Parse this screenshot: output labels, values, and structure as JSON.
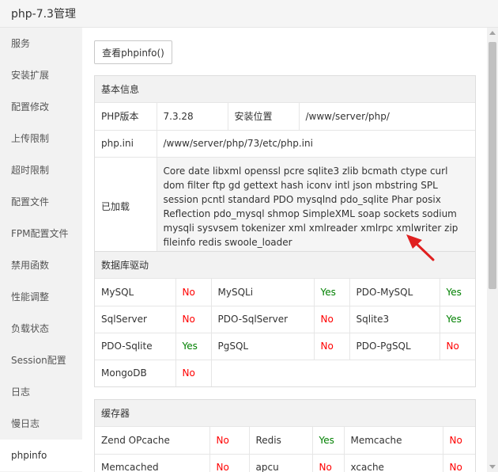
{
  "window": {
    "title": "php-7.3管理"
  },
  "sidebar": {
    "items": [
      {
        "label": "服务"
      },
      {
        "label": "安装扩展"
      },
      {
        "label": "配置修改"
      },
      {
        "label": "上传限制"
      },
      {
        "label": "超时限制"
      },
      {
        "label": "配置文件"
      },
      {
        "label": "FPM配置文件"
      },
      {
        "label": "禁用函数"
      },
      {
        "label": "性能调整"
      },
      {
        "label": "负载状态"
      },
      {
        "label": "Session配置"
      },
      {
        "label": "日志"
      },
      {
        "label": "慢日志"
      },
      {
        "label": "phpinfo"
      }
    ],
    "active_index": 13
  },
  "main": {
    "phpinfo_button": "查看phpinfo()",
    "basic_info": {
      "title": "基本信息",
      "php_version_label": "PHP版本",
      "php_version_value": "7.3.28",
      "install_path_label": "安装位置",
      "install_path_value": "/www/server/php/",
      "php_ini_label": "php.ini",
      "php_ini_value": "/www/server/php/73/etc/php.ini",
      "loaded_label": "已加载",
      "loaded_value": "Core date libxml openssl pcre sqlite3 zlib bcmath ctype curl dom filter ftp gd gettext hash iconv intl json mbstring SPL session pcntl standard PDO mysqlnd pdo_sqlite Phar posix Reflection pdo_mysql shmop SimpleXML soap sockets sodium mysqli sysvsem tokenizer xml xmlreader xmlrpc xmlwriter zip fileinfo redis swoole_loader"
    },
    "db_drivers": {
      "title": "数据库驱动",
      "rows": [
        [
          {
            "name": "MySQL",
            "status": "No"
          },
          {
            "name": "MySQLi",
            "status": "Yes"
          },
          {
            "name": "PDO-MySQL",
            "status": "Yes"
          }
        ],
        [
          {
            "name": "SqlServer",
            "status": "No"
          },
          {
            "name": "PDO-SqlServer",
            "status": "No"
          },
          {
            "name": "Sqlite3",
            "status": "Yes"
          }
        ],
        [
          {
            "name": "PDO-Sqlite",
            "status": "Yes"
          },
          {
            "name": "PgSQL",
            "status": "No"
          },
          {
            "name": "PDO-PgSQL",
            "status": "No"
          }
        ],
        [
          {
            "name": "MongoDB",
            "status": "No"
          }
        ]
      ]
    },
    "cache": {
      "title": "缓存器",
      "rows": [
        [
          {
            "name": "Zend OPcache",
            "status": "No"
          },
          {
            "name": "Redis",
            "status": "Yes"
          },
          {
            "name": "Memcache",
            "status": "No"
          }
        ],
        [
          {
            "name": "Memcached",
            "status": "No"
          },
          {
            "name": "apcu",
            "status": "No"
          },
          {
            "name": "xcache",
            "status": "No"
          }
        ]
      ]
    }
  },
  "colors": {
    "yes": "#008000",
    "no": "#ff0000",
    "arrow": "#e02020"
  },
  "icons": {
    "annotation": "arrow-icon"
  }
}
